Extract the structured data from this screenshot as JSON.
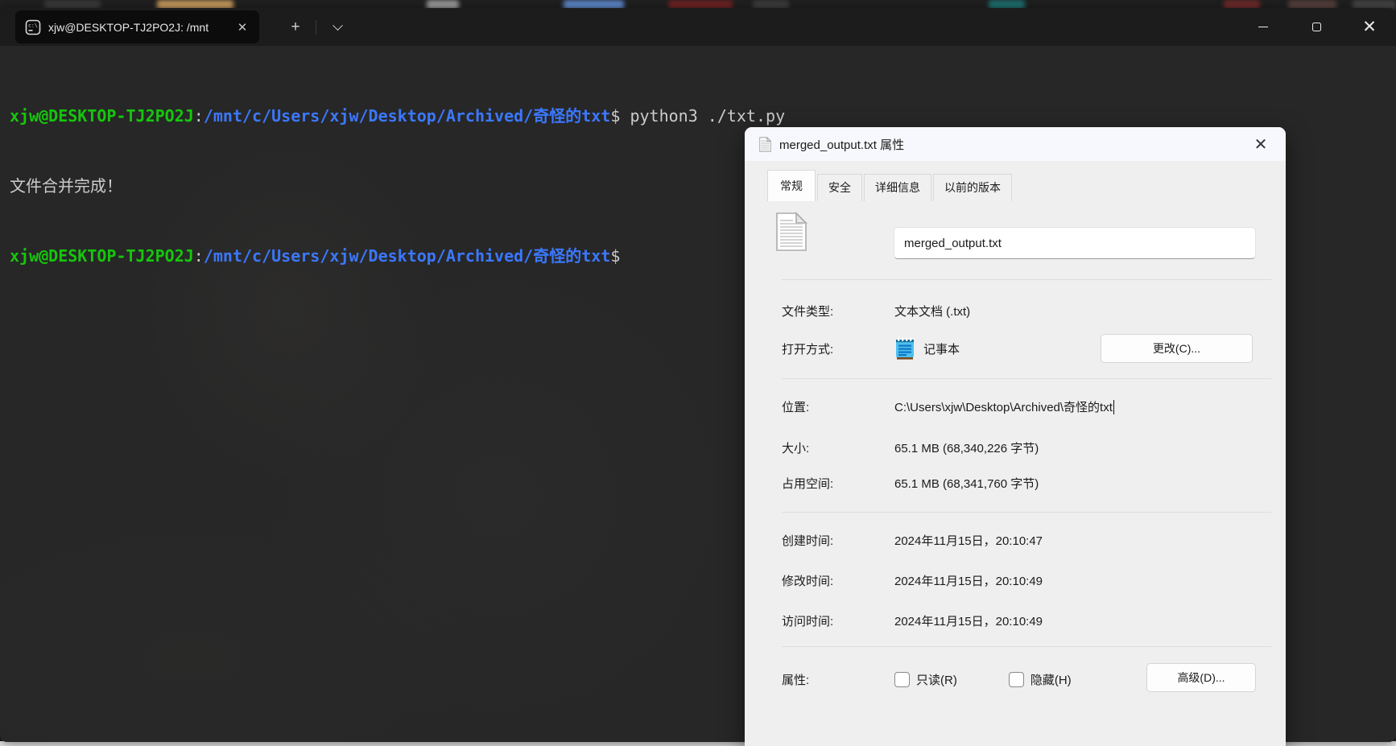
{
  "colors": {
    "terminal_background": "#272727",
    "terminal_prompt_green": "#16c60c",
    "terminal_path_blue": "#3b78ff",
    "terminal_foreground": "#cccccc",
    "tabbar_background": "#1c1c1c",
    "dialog_background": "#efefef"
  },
  "titlebar": {
    "tab_title": "xjw@DESKTOP-TJ2PO2J: /mnt"
  },
  "terminal": {
    "user": "xjw@DESKTOP-TJ2PO2J",
    "separator": ":",
    "path": "/mnt/c/Users/xjw/Desktop/Archived/奇怪的txt",
    "prompt_symbol": "$",
    "command": " python3 ./txt.py",
    "output_line": "文件合并完成！"
  },
  "dialog": {
    "title": "merged_output.txt 属性",
    "tabs": [
      {
        "label": "常规",
        "active": true
      },
      {
        "label": "安全",
        "active": false
      },
      {
        "label": "详细信息",
        "active": false
      },
      {
        "label": "以前的版本",
        "active": false
      }
    ],
    "filename_value": "merged_output.txt",
    "file_type": {
      "label": "文件类型:",
      "value": "文本文档 (.txt)"
    },
    "open_with": {
      "label": "打开方式:",
      "app": "记事本",
      "change_button": "更改(C)..."
    },
    "location": {
      "label": "位置:",
      "value": "C:\\Users\\xjw\\Desktop\\Archived\\奇怪的txt"
    },
    "size": {
      "label": "大小:",
      "value": "65.1 MB (68,340,226 字节)"
    },
    "size_on_disk": {
      "label": "占用空间:",
      "value": "65.1 MB (68,341,760 字节)"
    },
    "created": {
      "label": "创建时间:",
      "value": "2024年11月15日，20:10:47"
    },
    "modified": {
      "label": "修改时间:",
      "value": "2024年11月15日，20:10:49"
    },
    "accessed": {
      "label": "访问时间:",
      "value": "2024年11月15日，20:10:49"
    },
    "attributes": {
      "label": "属性:",
      "readonly_label": "只读(R)",
      "readonly_checked": false,
      "hidden_label": "隐藏(H)",
      "hidden_checked": false,
      "advanced_button": "高级(D)..."
    }
  }
}
